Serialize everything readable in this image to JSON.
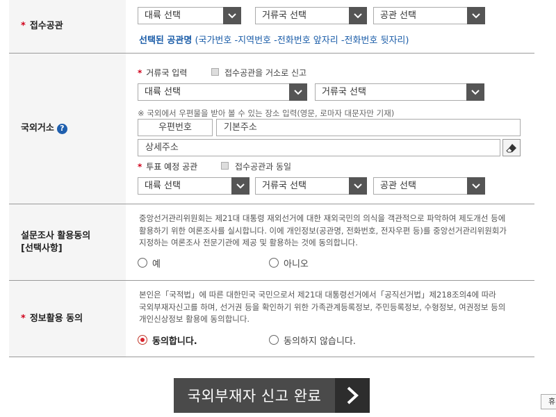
{
  "reception": {
    "label": "접수공관",
    "continent_select": "대륙 선택",
    "country_select": "거류국 선택",
    "office_select": "공관 선택",
    "office_name_title": "선택된 공관명",
    "office_name_format": "(국가번호 -지역번호 -전화번호 앞자리 -전화번호 뒷자리)"
  },
  "residence": {
    "label": "국외거소",
    "country_input_label": "거류국 입력",
    "same_as_office_label": "접수공관을 거소로 신고",
    "continent_select": "대륙 선택",
    "country_select": "거류국 선택",
    "address_note": "※ 국외에서 우편물을 받아 볼 수 있는 장소 입력(영문, 로마자 대문자만 기재)",
    "postal_code": "우편번호",
    "basic_address": "기본주소",
    "detail_address": "상세주소",
    "vote_office_label": "투표 예정 공관",
    "same_as_reception_label": "접수공관과 동일",
    "vote_continent_select": "대륙 선택",
    "vote_country_select": "거류국 선택",
    "vote_office_select": "공관 선택"
  },
  "survey": {
    "label_line1": "설문조사 활용동의",
    "label_line2": "[선택사항]",
    "text_line1": "중앙선거관리위원회는 제21대 대통령 재외선거에 대한 재외국민의 의식을 객관적으로 파악하여 제도개선 등에",
    "text_line2": "활용하기 위한 여론조사를 실시합니다. 이에 개인정보(공관명, 전화번호, 전자우편 등)를 중앙선거관리위원회가",
    "text_line3": "지정하는 여론조사 전문기관에 제공 및 활용하는 것에 동의합니다.",
    "yes": "예",
    "no": "아니오"
  },
  "consent": {
    "label": "정보활용 동의",
    "text_line1": "본인은「국적법」에 따른 대한민국 국민으로서 제21대 대통령선거에서「공직선거법」제218조의4에 따라",
    "text_line2": "국외부재자신고를 하며, 선거권 등을 확인하기 위한 가족관계등록정보, 주민등록정보, 수형정보, 여권정보 등의",
    "text_line3": "개인신상정보 활용에 동의합니다.",
    "agree": "동의합니다.",
    "disagree": "동의하지 않습니다."
  },
  "submit": {
    "label": "국외부재자 신고 완료"
  },
  "side_tab": {
    "label": "휴"
  },
  "colors": {
    "accent_blue": "#1a5ca8",
    "required_red": "#d0021b",
    "button_dark": "#4a4a4a"
  }
}
